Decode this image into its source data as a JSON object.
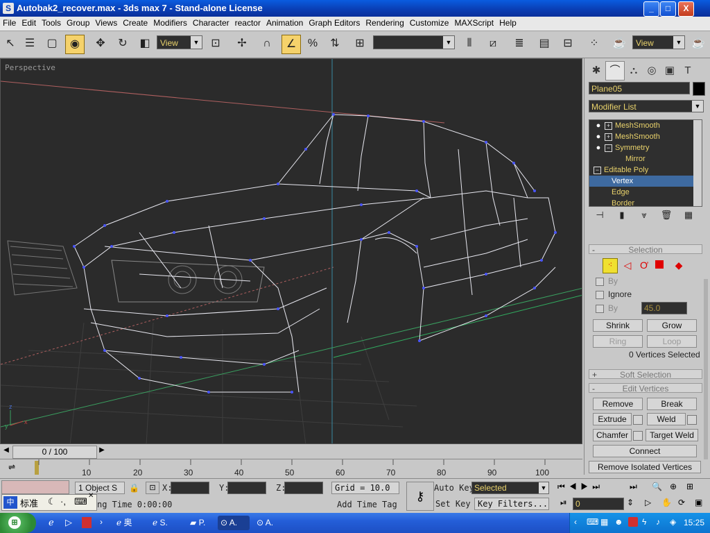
{
  "window": {
    "title": "Autobak2_recover.max - 3ds max 7 - Stand-alone License",
    "icon": "S",
    "minimize": "_",
    "maximize": "□",
    "close": "X"
  },
  "menu": [
    "File",
    "Edit",
    "Tools",
    "Group",
    "Views",
    "Create",
    "Modifiers",
    "Character",
    "reactor",
    "Animation",
    "Graph Editors",
    "Rendering",
    "Customize",
    "MAXScript",
    "Help"
  ],
  "toolbar": {
    "ref_coord_value": "View",
    "named_sel_value": "",
    "render_view_value": "View"
  },
  "viewport": {
    "label": "Perspective"
  },
  "command_panel": {
    "object_name": "Plane05",
    "modifier_list": "Modifier List",
    "stack": [
      {
        "label": "MeshSmooth",
        "kind": "modifier"
      },
      {
        "label": "MeshSmooth",
        "kind": "modifier"
      },
      {
        "label": "Symmetry",
        "kind": "modifier-open"
      },
      {
        "label": "Mirror",
        "kind": "sub"
      },
      {
        "label": "Editable Poly",
        "kind": "base"
      },
      {
        "label": "Vertex",
        "kind": "sub-selected"
      },
      {
        "label": "Edge",
        "kind": "sub"
      },
      {
        "label": "Border",
        "kind": "sub"
      }
    ],
    "selection": {
      "header": "Selection",
      "by_label": "By",
      "ignore_label": "Ignore",
      "by_angle_label": "By",
      "angle_value": "45.0",
      "shrink": "Shrink",
      "grow": "Grow",
      "ring": "Ring",
      "loop": "Loop",
      "status": "0 Vertices Selected"
    },
    "soft_selection": {
      "header": "Soft Selection"
    },
    "edit_vertices": {
      "header": "Edit Vertices",
      "remove": "Remove",
      "break": "Break",
      "extrude": "Extrude",
      "weld": "Weld",
      "chamfer": "Chamfer",
      "target_weld": "Target Weld",
      "connect": "Connect",
      "remove_isolated": "Remove Isolated Vertices"
    }
  },
  "timeline": {
    "slider": "0 / 100",
    "ticks": [
      "10",
      "20",
      "30",
      "40",
      "50",
      "60",
      "70",
      "80",
      "90",
      "100"
    ]
  },
  "status": {
    "selection_count": "1 Object S",
    "x_label": "X:",
    "y_label": "Y:",
    "z_label": "Z:",
    "grid": "Grid = 10.0",
    "auto_key": "Auto Key",
    "set_key": "Set Key",
    "selected_value": "Selected",
    "key_filters": "Key Filters...",
    "time_text": "ng Time  0:00:00",
    "add_time_tag": "Add Time Tag",
    "frame_value": "0"
  },
  "ime": {
    "text": "标准"
  },
  "taskbar": {
    "tasks": [
      {
        "label": "奥"
      },
      {
        "label": "S."
      },
      {
        "label": "P."
      },
      {
        "label": "A."
      },
      {
        "label": "A."
      }
    ],
    "clock": "15:25"
  }
}
